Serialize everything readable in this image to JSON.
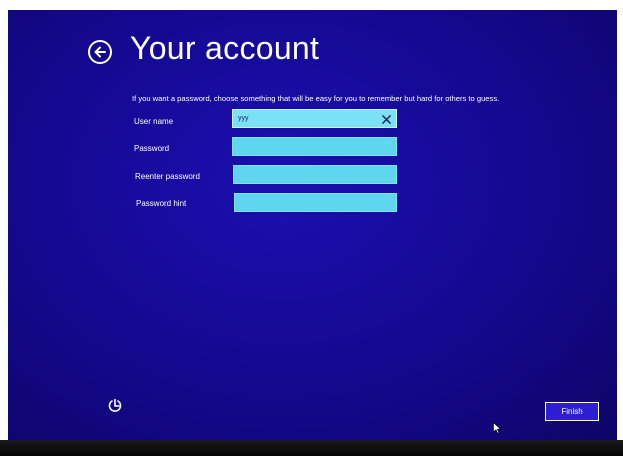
{
  "header": {
    "title": "Your account",
    "back_icon": "back-arrow-circle-icon"
  },
  "instructions": "If you want a password, choose something that will be easy for you to remember but hard for others to guess.",
  "form": {
    "username_label": "User name",
    "username_value": "yyy",
    "password_label": "Password",
    "password_value": "",
    "reenter_label": "Reenter password",
    "reenter_value": "",
    "hint_label": "Password hint",
    "hint_value": ""
  },
  "footer": {
    "finish_label": "Finish",
    "power_icon": "ease-of-access-icon"
  },
  "colors": {
    "background": "#14088f",
    "field": "#5fd6ee",
    "text": "#ffffff",
    "button": "#2c1fd2"
  }
}
